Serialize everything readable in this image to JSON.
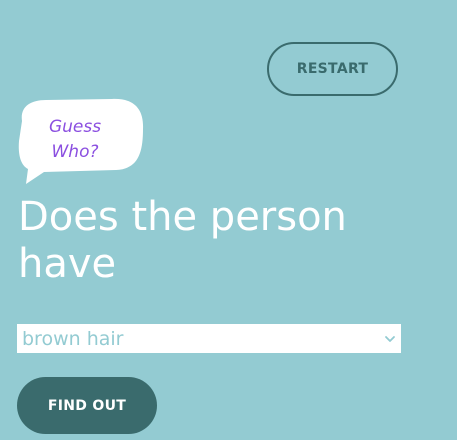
{
  "header": {
    "restart_label": "RESTART"
  },
  "bubble": {
    "line1": "Guess",
    "line2": "Who?"
  },
  "question": {
    "text": "Does the person have"
  },
  "attribute_select": {
    "selected_value": "brown hair",
    "icon": "chevron-down-icon"
  },
  "actions": {
    "find_out_label": "FIND OUT"
  },
  "colors": {
    "background": "#93cbd2",
    "button_dark": "#3a6b6d",
    "bubble_text": "#8b4fe0",
    "heading_text": "#ffffff"
  }
}
